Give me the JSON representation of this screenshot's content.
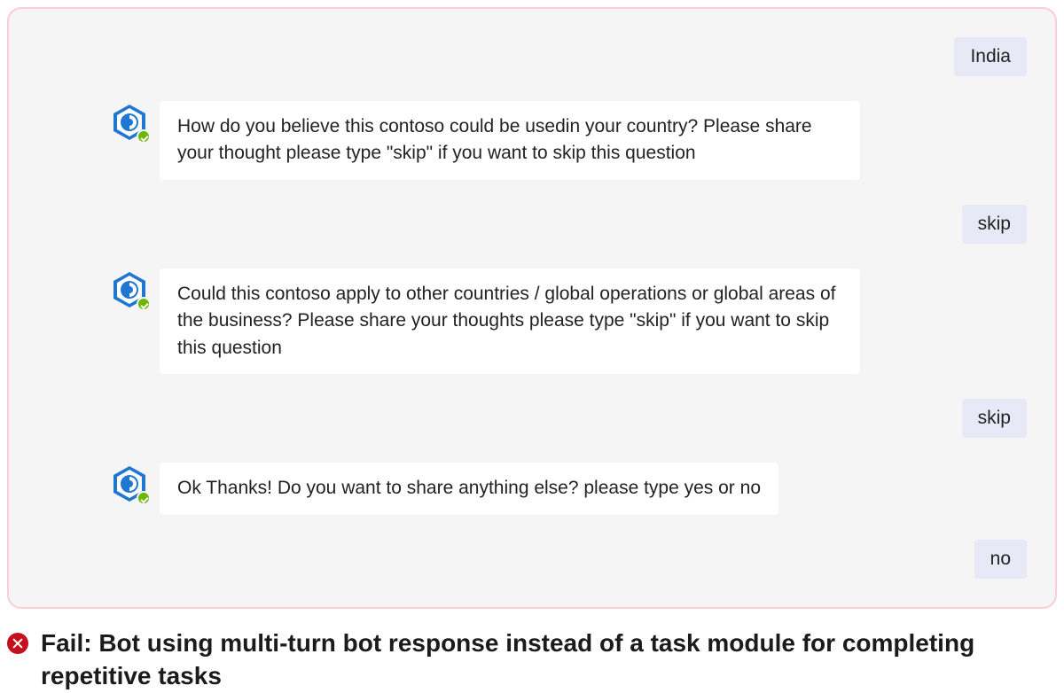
{
  "conversation": {
    "messages": [
      {
        "from": "user",
        "text": "India"
      },
      {
        "from": "bot",
        "text": "How do you believe this contoso could be usedin your country? Please share your thought please type \"skip\" if you want to skip this question"
      },
      {
        "from": "user",
        "text": "skip"
      },
      {
        "from": "bot",
        "text": "Could this contoso apply to other countries / global operations or global areas of the business? Please share your thoughts please type \"skip\" if you want to skip this question"
      },
      {
        "from": "user",
        "text": "skip"
      },
      {
        "from": "bot",
        "text": "Ok Thanks! Do you want to share anything else? please type yes or no"
      },
      {
        "from": "user",
        "text": "no"
      }
    ]
  },
  "caption": {
    "status": "fail",
    "text": "Fail: Bot using multi-turn bot response instead of a task module for completing repetitive tasks"
  }
}
